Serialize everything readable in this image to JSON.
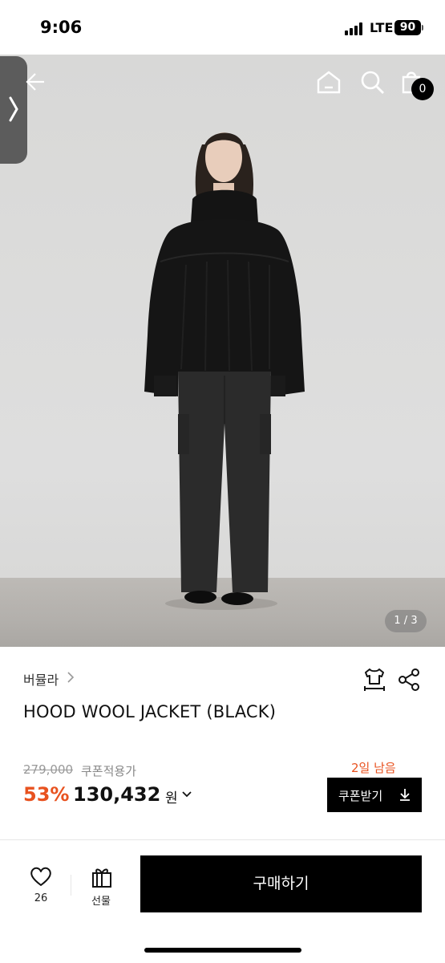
{
  "status_bar": {
    "time": "9:06",
    "network": "LTE",
    "battery": "90"
  },
  "hero": {
    "page_indicator": "1 / 3",
    "cart_count": "0"
  },
  "product": {
    "brand": "버뮬라",
    "title": "HOOD WOOL JACKET (BLACK)",
    "original_price": "279,000",
    "coupon_label": "쿠폰적용가",
    "discount": "53%",
    "sale_price": "130,432",
    "currency": "원",
    "days_left": "2일 남음",
    "coupon_button": "쿠폰받기"
  },
  "bottom_bar": {
    "like_count": "26",
    "gift_label": "선물",
    "buy_label": "구매하기"
  },
  "colors": {
    "accent": "#e8521f",
    "primary": "#000000"
  },
  "icons": [
    "back-arrow-icon",
    "home-icon",
    "search-icon",
    "cart-icon",
    "chevron-right-icon",
    "size-guide-icon",
    "share-icon",
    "chevron-down-icon",
    "download-icon",
    "heart-icon",
    "gift-icon"
  ]
}
